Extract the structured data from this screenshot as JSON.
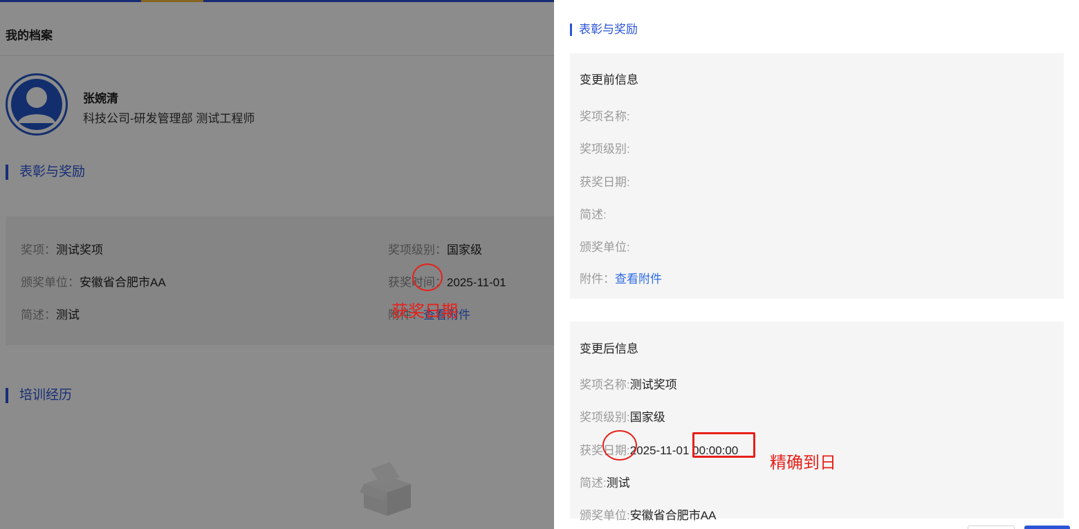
{
  "page": {
    "title": "我的档案"
  },
  "profile": {
    "name": "张婉清",
    "dept": "科技公司-研发管理部 测试工程师"
  },
  "sections": {
    "awards": "表彰与奖励",
    "training": "培训经历"
  },
  "award_card": {
    "item_label": "奖项：",
    "item_value": "测试奖项",
    "level_label": "奖项级别：",
    "level_value": "国家级",
    "unit_label": "颁奖单位：",
    "unit_value": "安徽省合肥市AA",
    "time_label": "获奖时间：",
    "time_value": "2025-11-01",
    "desc_label": "简述：",
    "desc_value": "测试",
    "attach_label": "附件：",
    "attach_link": "查看附件"
  },
  "drawer": {
    "title": "表彰与奖励",
    "before": {
      "heading": "变更前信息",
      "name_label": "奖项名称:",
      "level_label": "奖项级别:",
      "date_label": "获奖日期:",
      "desc_label": "简述:",
      "unit_label": "颁奖单位:",
      "attach_label": "附件：",
      "attach_link": "查看附件"
    },
    "after": {
      "heading": "变更后信息",
      "name_label": "奖项名称:",
      "name_value": "测试奖项",
      "level_label": "奖项级别:",
      "level_value": "国家级",
      "date_label": "获奖日期:",
      "date_value": "2025-11-01",
      "time_value": "00:00:00",
      "desc_label": "简述:",
      "desc_value": "测试",
      "unit_label": "颁奖单位:",
      "unit_value": "安徽省合肥市AA"
    }
  },
  "annotations": {
    "left_note": "获奖日期",
    "right_note": "精确到日",
    "color": "#e8201a"
  },
  "colors": {
    "brand_blue": "#2b55d6",
    "link_blue": "#2e6be6"
  }
}
